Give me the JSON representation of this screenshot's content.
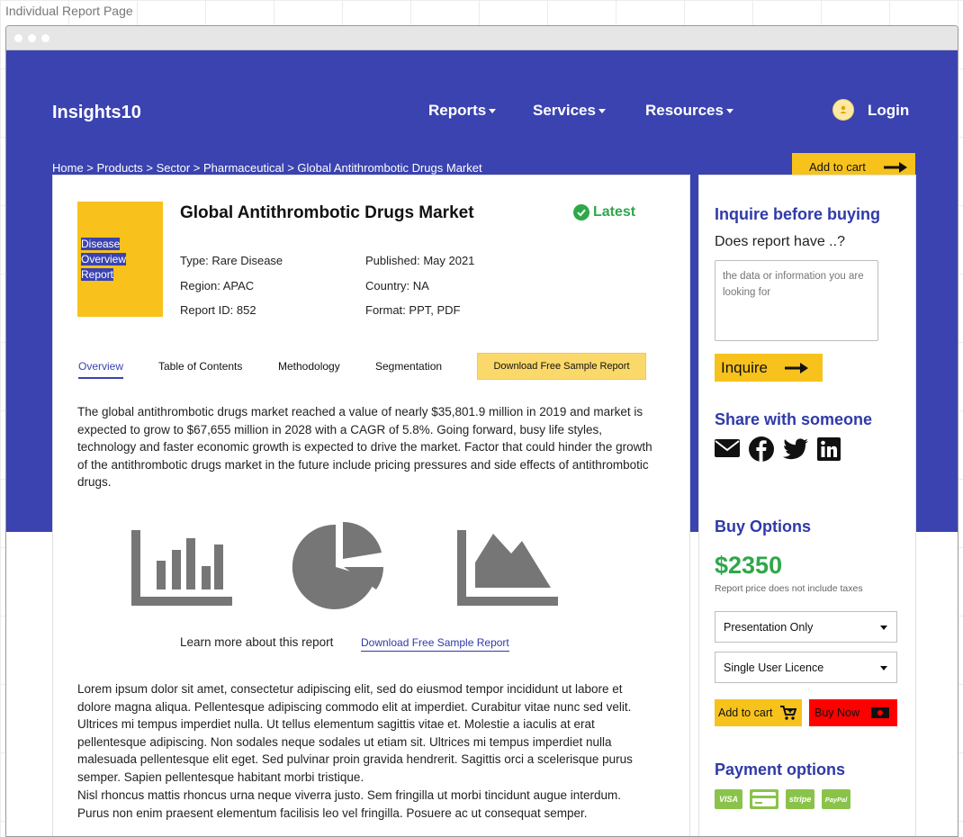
{
  "page_caption": "Individual Report Page",
  "brand": "Insights10",
  "nav": {
    "reports": "Reports",
    "services": "Services",
    "resources": "Resources",
    "login": "Login"
  },
  "breadcrumb": "Home > Products > Sector > Pharmaceutical > Global Antithrombotic Drugs Market",
  "add_to_cart_top": "Add to cart",
  "report": {
    "cover": [
      "Disease",
      "Overview",
      "Report"
    ],
    "title": "Global Antithrombotic Drugs Market",
    "badge": "Latest",
    "type": "Type: Rare Disease",
    "region": "Region: APAC",
    "report_id": "Report ID: 852",
    "published": "Published: May 2021",
    "country": "Country: NA",
    "format": "Format: PPT, PDF"
  },
  "tabs": {
    "overview": "Overview",
    "toc": "Table of Contents",
    "methodology": "Methodology",
    "segmentation": "Segmentation",
    "download": "Download Free Sample Report"
  },
  "overview_text": "The global antithrombotic drugs market reached a value of nearly $35,801.9 million in 2019 and market is expected to grow to $67,655 million in 2028 with a CAGR of 5.8%. Going forward, busy life styles, technology and faster economic growth is expected to drive the market. Factor that could hinder the growth of the antithrombotic drugs market in the future include pricing pressures and side effects of antithrombotic drugs.",
  "icons": {
    "bar": "bar-chart-icon",
    "pie": "pie-chart-icon",
    "area": "area-chart-icon"
  },
  "learn_more": "Learn more about this report",
  "learn_link": "Download Free Sample Report",
  "lorem_1": "Lorem ipsum dolor sit amet, consectetur adipiscing elit, sed do eiusmod tempor incididunt ut labore et dolore magna aliqua. Pellentesque adipiscing commodo elit at imperdiet. Curabitur vitae nunc sed velit. Ultrices mi tempus imperdiet nulla. Ut tellus elementum sagittis vitae et. Molestie a iaculis at erat pellentesque adipiscing. Non sodales neque sodales ut etiam sit. Ultrices mi tempus imperdiet nulla malesuada pellentesque elit eget. Sed pulvinar proin gravida hendrerit. Sagittis orci a scelerisque purus semper. Sapien pellentesque habitant morbi tristique.",
  "lorem_2": "Nisl rhoncus mattis rhoncus urna neque viverra justo. Sem fringilla ut morbi tincidunt augue interdum. Purus non enim praesent elementum facilisis leo vel fringilla. Posuere ac ut consequat semper.",
  "sidebar": {
    "inquire_title": "Inquire before buying",
    "question": "Does report have ..?",
    "placeholder": "the data or information you are looking for",
    "inquire_btn": "Inquire",
    "share_title": "Share with someone",
    "buy_title": "Buy Options",
    "price": "$2350",
    "price_note": "Report price does not include taxes",
    "select_format": "Presentation Only",
    "select_licence": "Single User Licence",
    "add_to_cart": "Add to cart",
    "buy_now": "Buy Now",
    "payment_title": "Payment options",
    "payments": [
      "VISA",
      "",
      "stripe",
      "PayPal"
    ]
  },
  "colors": {
    "brand": "#3a43b0",
    "accent": "#f7c21b",
    "success": "#2ea84a",
    "buy": "#ff0000"
  }
}
